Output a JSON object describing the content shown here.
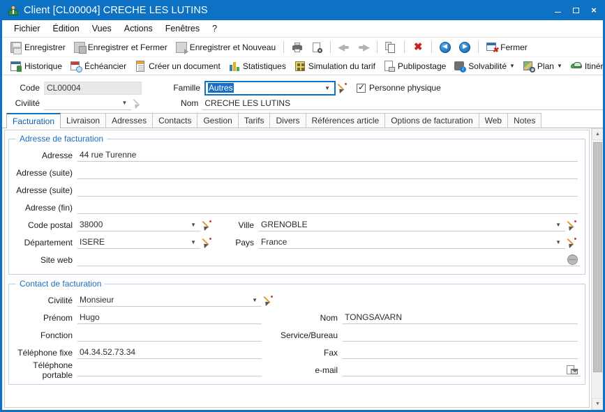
{
  "window": {
    "title": "Client [CL00004] CRECHE LES LUTINS",
    "icon": "client-person-icon",
    "minimize": "–",
    "maximize": "□",
    "close": "×",
    "accent_color": "#0d72c4"
  },
  "menubar": {
    "items": [
      {
        "label": "Fichier"
      },
      {
        "label": "Édition"
      },
      {
        "label": "Vues"
      },
      {
        "label": "Actions"
      },
      {
        "label": "Fenêtres"
      },
      {
        "label": "?"
      }
    ]
  },
  "toolbar_primary": {
    "items": [
      {
        "label": "Enregistrer",
        "icon": "save-icon"
      },
      {
        "label": "Enregistrer et Fermer",
        "icon": "save-and-close-icon"
      },
      {
        "label": "Enregistrer et Nouveau",
        "icon": "save-and-new-icon"
      },
      {
        "label": "",
        "icon": "print-icon"
      },
      {
        "label": "",
        "icon": "print-preview-icon"
      },
      {
        "label": "",
        "icon": "undo-icon"
      },
      {
        "label": "",
        "icon": "redo-icon"
      },
      {
        "label": "",
        "icon": "copy-icon"
      },
      {
        "label": "",
        "icon": "delete-icon"
      },
      {
        "label": "",
        "icon": "previous-record-icon"
      },
      {
        "label": "",
        "icon": "next-record-icon"
      },
      {
        "label": "Fermer",
        "icon": "close-window-icon"
      }
    ]
  },
  "toolbar_secondary": {
    "items": [
      {
        "label": "Historique",
        "icon": "history-icon",
        "has_dropdown": false
      },
      {
        "label": "Échéancier",
        "icon": "schedule-icon",
        "has_dropdown": false
      },
      {
        "label": "Créer un document",
        "icon": "create-document-icon",
        "has_dropdown": false
      },
      {
        "label": "Statistiques",
        "icon": "statistics-icon",
        "has_dropdown": false
      },
      {
        "label": "Simulation du tarif",
        "icon": "tariff-simulation-icon",
        "has_dropdown": false
      },
      {
        "label": "Publipostage",
        "icon": "mail-merge-icon",
        "has_dropdown": false
      },
      {
        "label": "Solvabilité",
        "icon": "solvency-icon",
        "has_dropdown": true
      },
      {
        "label": "Plan",
        "icon": "map-icon",
        "has_dropdown": true
      },
      {
        "label": "Itinéraire",
        "icon": "route-icon",
        "has_dropdown": true
      }
    ],
    "overflow_label": "⌄"
  },
  "header_form": {
    "code": {
      "label": "Code",
      "value": "CL00004",
      "readonly": true
    },
    "civilite": {
      "label": "Civilité",
      "value": "",
      "placeholder": ""
    },
    "famille": {
      "label": "Famille",
      "value": "Autres",
      "focused": true,
      "selected": true
    },
    "nom": {
      "label": "Nom",
      "value": "CRECHE LES LUTINS"
    },
    "personne_physique": {
      "label": "Personne physique",
      "checked": true
    }
  },
  "tabs": {
    "active": "Facturation",
    "items": [
      {
        "label": "Facturation"
      },
      {
        "label": "Livraison"
      },
      {
        "label": "Adresses"
      },
      {
        "label": "Contacts"
      },
      {
        "label": "Gestion"
      },
      {
        "label": "Tarifs"
      },
      {
        "label": "Divers"
      },
      {
        "label": "Références article"
      },
      {
        "label": "Options de facturation"
      },
      {
        "label": "Web"
      },
      {
        "label": "Notes"
      }
    ]
  },
  "adresse_facturation": {
    "title": "Adresse de facturation",
    "adresse": {
      "label": "Adresse",
      "value": "44 rue Turenne"
    },
    "adresse_suite_1": {
      "label": "Adresse (suite)",
      "value": ""
    },
    "adresse_suite_2": {
      "label": "Adresse (suite)",
      "value": ""
    },
    "adresse_fin": {
      "label": "Adresse (fin)",
      "value": ""
    },
    "code_postal": {
      "label": "Code postal",
      "value": "38000"
    },
    "ville": {
      "label": "Ville",
      "value": "GRENOBLE"
    },
    "departement": {
      "label": "Département",
      "value": "ISERE"
    },
    "pays": {
      "label": "Pays",
      "value": "France"
    },
    "site_web": {
      "label": "Site web",
      "value": "",
      "icon": "globe-icon"
    }
  },
  "contact_facturation": {
    "title": "Contact de facturation",
    "civilite": {
      "label": "Civilité",
      "value": "Monsieur"
    },
    "nom": {
      "label": "Nom",
      "value": "TONGSAVARN"
    },
    "prenom": {
      "label": "Prénom",
      "value": "Hugo"
    },
    "service_bureau": {
      "label": "Service/Bureau",
      "value": ""
    },
    "fonction": {
      "label": "Fonction",
      "value": ""
    },
    "fax": {
      "label": "Fax",
      "value": ""
    },
    "telephone_fixe": {
      "label": "Téléphone fixe",
      "value": "04.34.52.73.34"
    },
    "email": {
      "label": "e-mail",
      "value": "",
      "icon": "email-icon"
    },
    "telephone_portable": {
      "label": "Téléphone portable",
      "value": ""
    }
  },
  "scrollbar": {
    "up_arrow": "▲",
    "down_arrow": "▼"
  }
}
